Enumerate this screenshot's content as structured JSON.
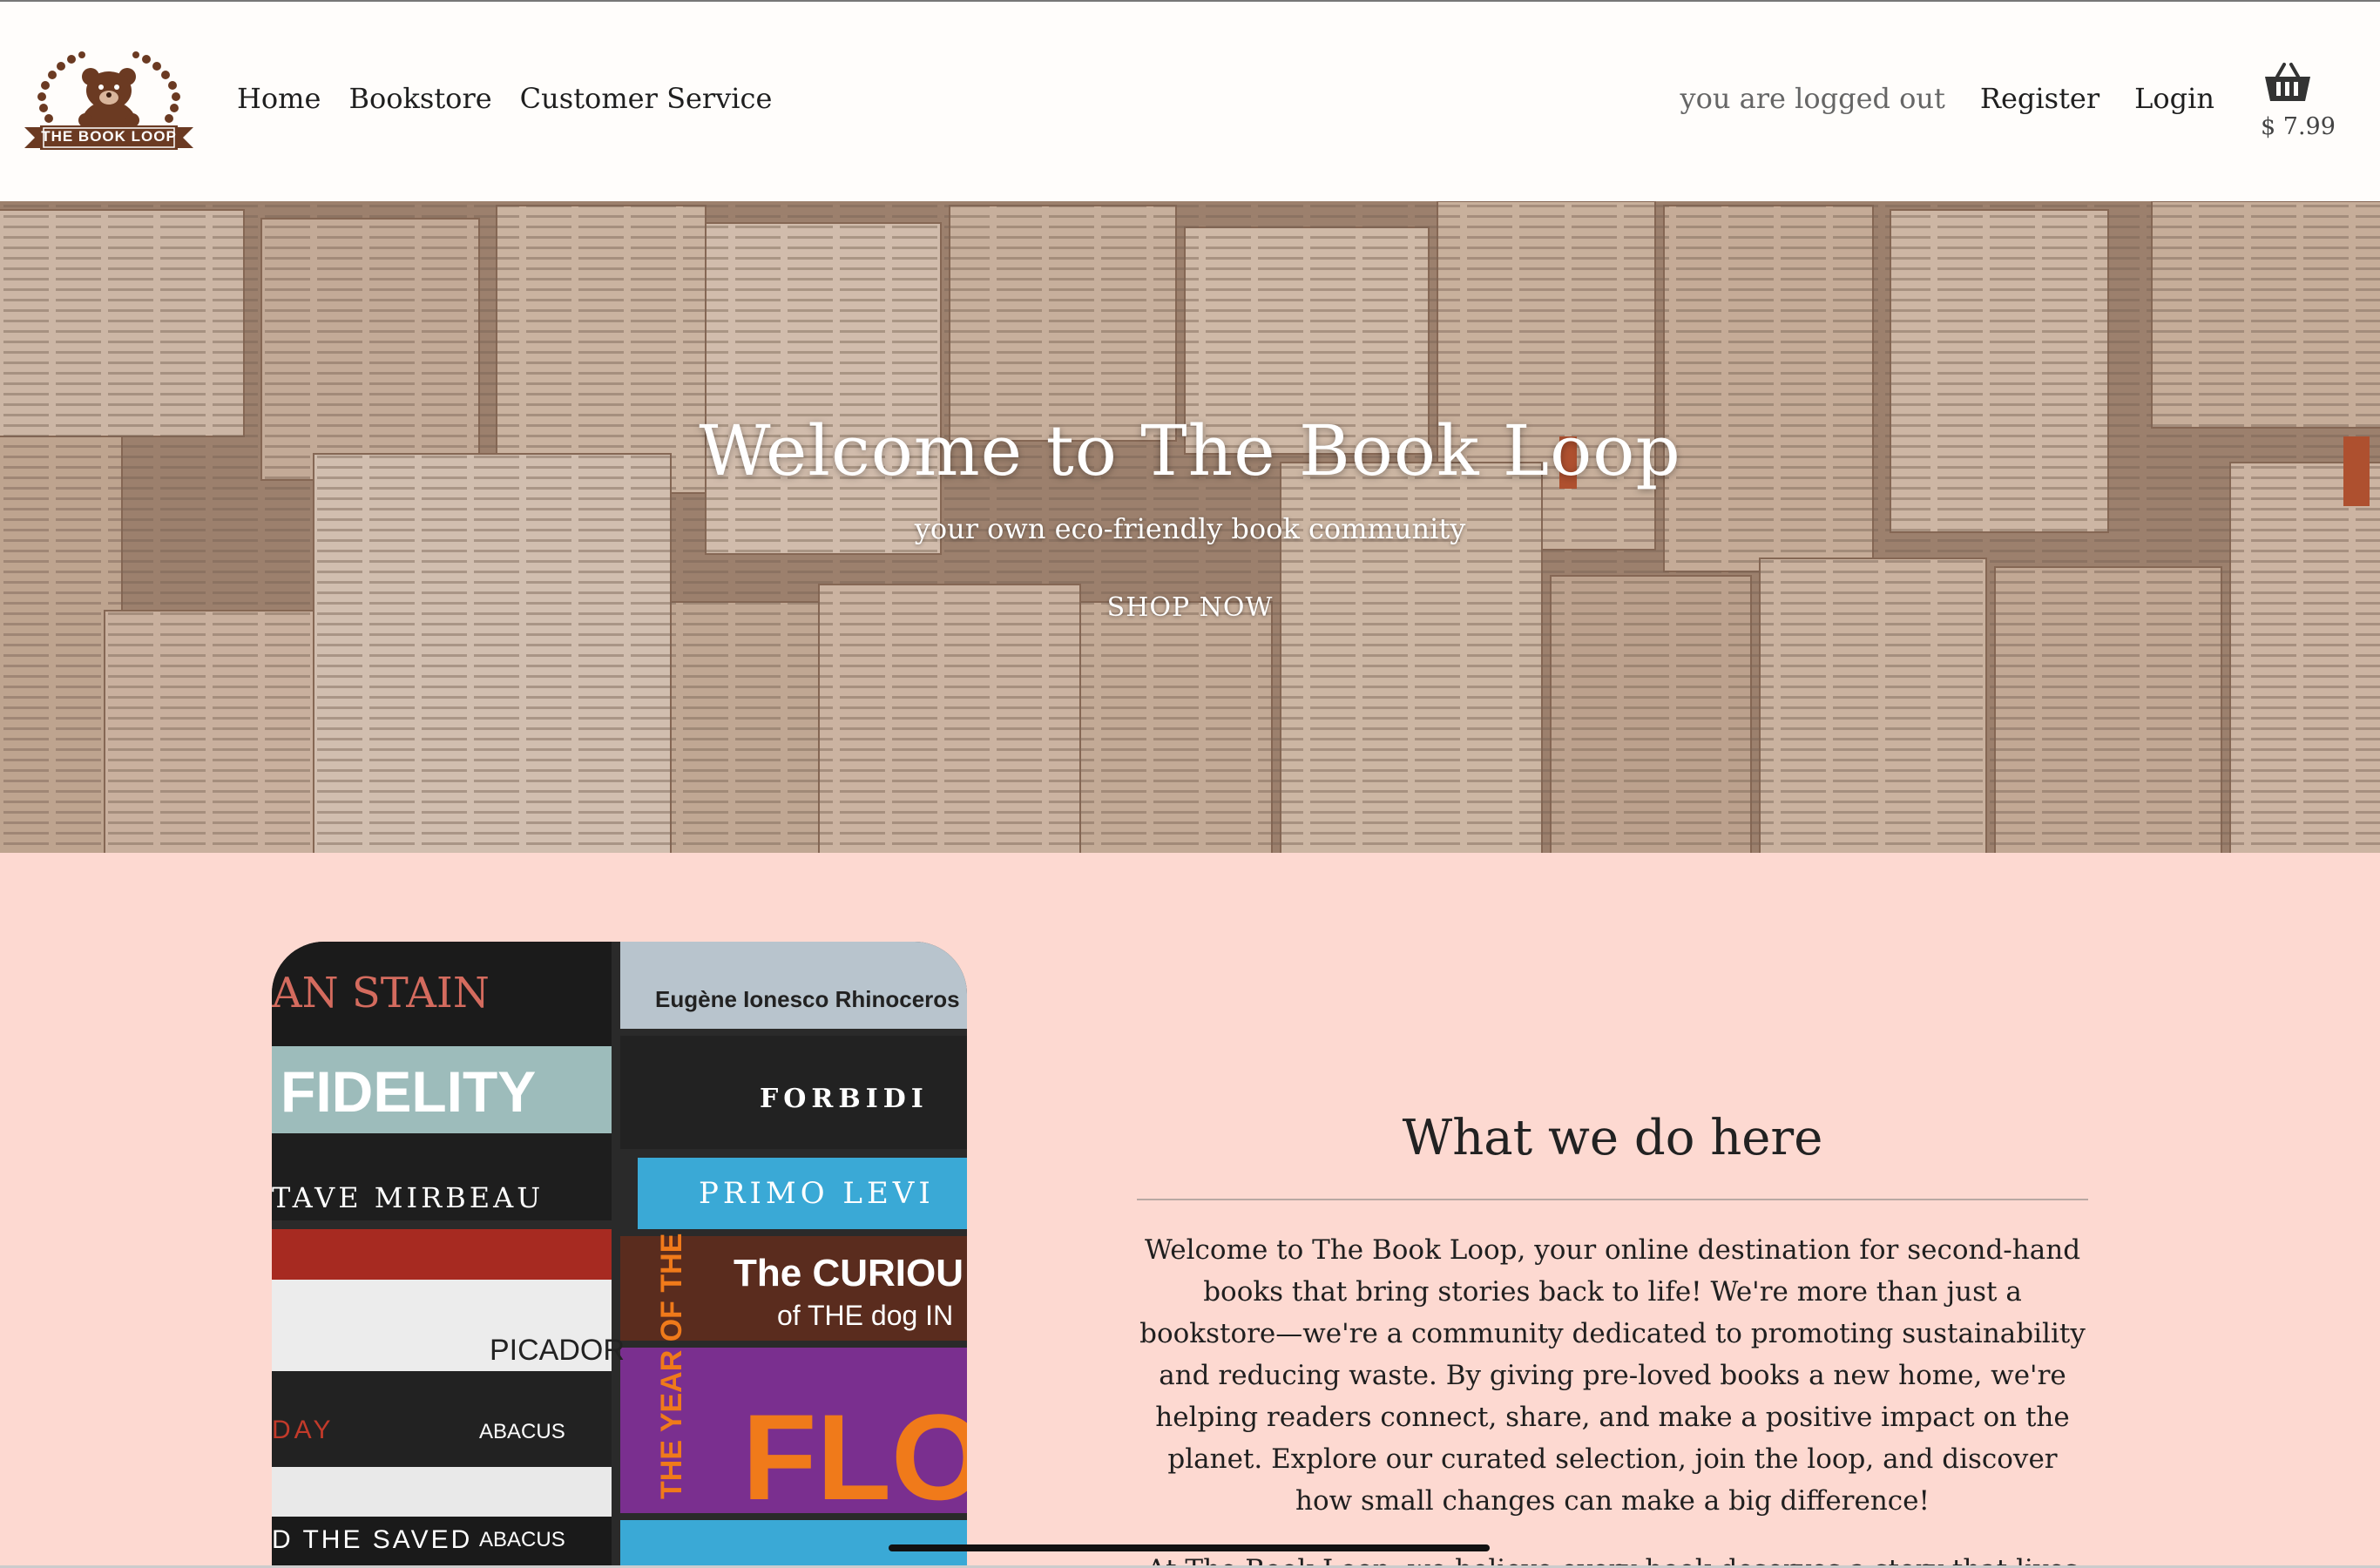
{
  "brand": {
    "logo_text": "THE BOOK LOOP",
    "colors": {
      "brown": "#6b3a22",
      "header_bg": "#fffdfb",
      "section_bg": "#fdd9d1"
    }
  },
  "nav": {
    "items": [
      {
        "label": "Home"
      },
      {
        "label": "Bookstore"
      },
      {
        "label": "Customer Service"
      }
    ]
  },
  "auth": {
    "status": "you are logged out",
    "register": "Register",
    "login": "Login"
  },
  "cart": {
    "icon": "basket-icon",
    "total": "$ 7.99"
  },
  "hero": {
    "title": "Welcome to The Book Loop",
    "subtitle": "your own eco-friendly book community",
    "cta": "SHOP NOW"
  },
  "about": {
    "title": "What we do here",
    "paragraph": "Welcome to The Book Loop, your online destination for second-hand books that bring stories back to life! We're more than just a bookstore—we're a community dedicated to promoting sustainability and reducing waste. By giving pre-loved books a new home, we're helping readers connect, share, and make a positive impact on the planet. Explore our curated selection, join the loop, and discover how small changes can make a big difference!",
    "paragraph_2": "At The Book Loop, we believe every book deserves a story that lives on and on.",
    "book_spines": [
      {
        "text": "AN STAIN"
      },
      {
        "text": "Eugène Ionesco Rhinoceros"
      },
      {
        "text": "FIDELITY"
      },
      {
        "text": "FORBIDI"
      },
      {
        "text": "TAVE MIRBEAU"
      },
      {
        "text": "PRIMO LEVI"
      },
      {
        "text": "The CURIOU"
      },
      {
        "text": "of THE dog IN"
      },
      {
        "text": "PICADOR"
      },
      {
        "text": "THE YEAR OF THE"
      },
      {
        "text": "FLOO"
      },
      {
        "text": "DAY"
      },
      {
        "text": "ABACUS"
      },
      {
        "text": "D THE SAVED"
      },
      {
        "text": "ABACUS"
      }
    ]
  }
}
